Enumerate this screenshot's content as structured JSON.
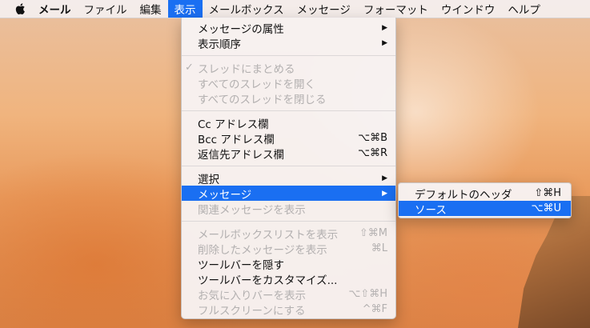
{
  "menubar": {
    "items": [
      "メール",
      "ファイル",
      "編集",
      "表示",
      "メールボックス",
      "メッセージ",
      "フォーマット",
      "ウインドウ",
      "ヘルプ"
    ]
  },
  "view_menu": {
    "attributes": "メッセージの属性",
    "sort_order": "表示順序",
    "organize_threads": "スレッドにまとめる",
    "check_mark": "✓",
    "open_all_threads": "すべてのスレッドを開く",
    "close_all_threads": "すべてのスレッドを閉じる",
    "cc_field": "Cc アドレス欄",
    "bcc_field": "Bcc アドレス欄",
    "bcc_shortcut": "⌥⌘B",
    "reply_to_field": "返信先アドレス欄",
    "reply_to_shortcut": "⌥⌘R",
    "select": "選択",
    "message": "メッセージ",
    "related_messages": "関連メッセージを表示",
    "mailbox_list": "メールボックスリストを表示",
    "mailbox_list_shortcut": "⇧⌘M",
    "deleted_messages": "削除したメッセージを表示",
    "deleted_messages_shortcut": "⌘L",
    "hide_toolbar": "ツールバーを隠す",
    "customize_toolbar": "ツールバーをカスタマイズ...",
    "favorites_bar": "お気に入りバーを表示",
    "favorites_bar_shortcut": "⌥⇧⌘H",
    "fullscreen": "フルスクリーンにする",
    "fullscreen_shortcut": "^⌘F",
    "submenu_arrow": "▶"
  },
  "message_submenu": {
    "default_headers": "デフォルトのヘッダ",
    "default_headers_shortcut": "⇧⌘H",
    "source": "ソース",
    "source_shortcut": "⌥⌘U"
  },
  "colors": {
    "highlight": "#1a6ff2",
    "disabled_text": "#b3b0b0"
  }
}
